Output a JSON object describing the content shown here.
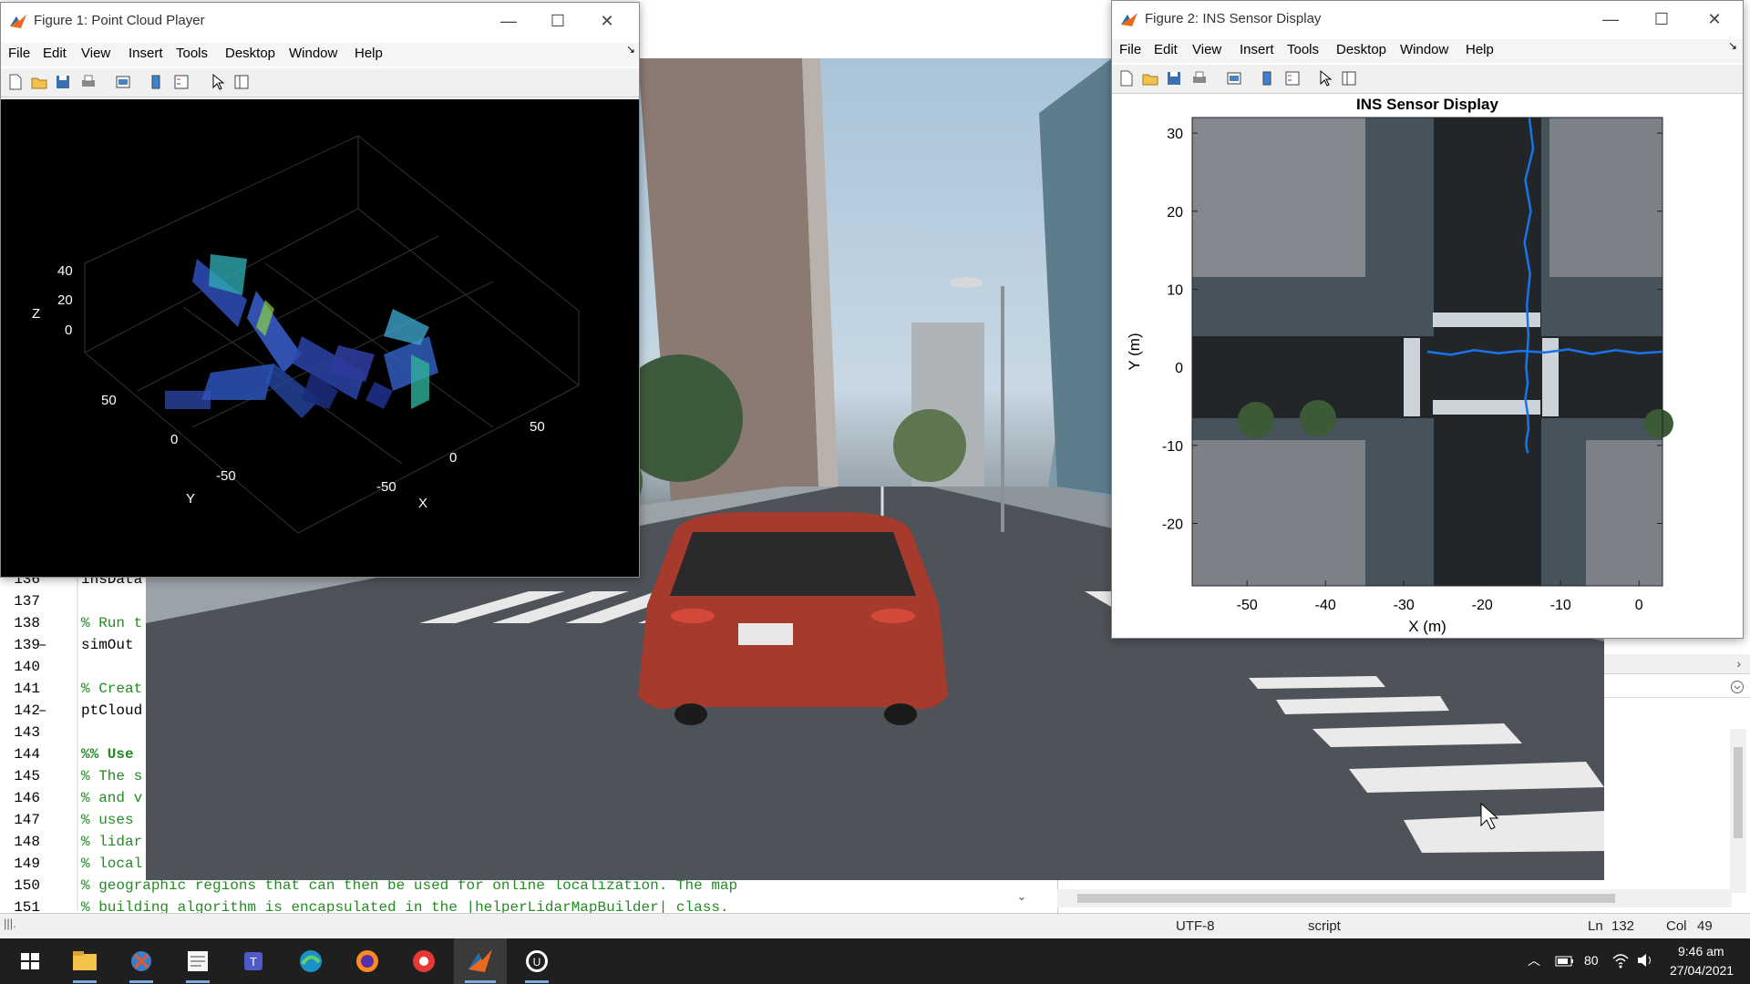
{
  "editor": {
    "lines": [
      {
        "num": "136",
        "dash": false,
        "text": "insData",
        "style": "code"
      },
      {
        "num": "137",
        "dash": false,
        "text": "",
        "style": "code"
      },
      {
        "num": "138",
        "dash": false,
        "text": "% Run t",
        "style": "cmt"
      },
      {
        "num": "139",
        "dash": true,
        "text": "simOut",
        "style": "code"
      },
      {
        "num": "140",
        "dash": false,
        "text": "",
        "style": "code"
      },
      {
        "num": "141",
        "dash": false,
        "text": "% Creat",
        "style": "cmt"
      },
      {
        "num": "142",
        "dash": true,
        "text": "ptCloud",
        "style": "code"
      },
      {
        "num": "143",
        "dash": false,
        "text": "",
        "style": "code"
      },
      {
        "num": "144",
        "dash": false,
        "text": "%% Use",
        "style": "cmt-b"
      },
      {
        "num": "145",
        "dash": false,
        "text": "% The s",
        "style": "cmt"
      },
      {
        "num": "146",
        "dash": false,
        "text": "% and v",
        "style": "cmt"
      },
      {
        "num": "147",
        "dash": false,
        "text": "% uses",
        "style": "cmt"
      },
      {
        "num": "148",
        "dash": false,
        "text": "% lidar",
        "style": "cmt"
      },
      {
        "num": "149",
        "dash": false,
        "text": "% local",
        "style": "cmt"
      },
      {
        "num": "150",
        "dash": false,
        "text": "% geographic regions that can then be used for online localization. The map",
        "style": "cmt"
      },
      {
        "num": "151",
        "dash": false,
        "text": "% building algorithm is encapsulated in the |helperLidarMapBuilder| class.",
        "style": "cmt"
      }
    ]
  },
  "figure1": {
    "title": "Figure 1: Point Cloud Player",
    "menu": [
      "File",
      "Edit",
      "View",
      "Insert",
      "Tools",
      "Desktop",
      "Window",
      "Help"
    ],
    "axes": {
      "zlabel": "Z",
      "ylabel": "Y",
      "xlabel": "X",
      "zticks": [
        "40",
        "20",
        "0"
      ],
      "yticks": [
        "50",
        "0",
        "-50"
      ],
      "xticks": [
        "50",
        "0",
        "-50"
      ]
    }
  },
  "figure2": {
    "title": "Figure 2: INS Sensor Display",
    "menu": [
      "File",
      "Edit",
      "View",
      "Insert",
      "Tools",
      "Desktop",
      "Window",
      "Help"
    ],
    "plot_title": "INS Sensor Display",
    "xlabel": "X (m)",
    "ylabel": "Y (m)"
  },
  "chart_data": {
    "type": "line",
    "title": "INS Sensor Display",
    "xlabel": "X (m)",
    "ylabel": "Y (m)",
    "xlim": [
      -57,
      3
    ],
    "ylim": [
      -28,
      32
    ],
    "xticks": [
      -50,
      -40,
      -30,
      -20,
      -10,
      0
    ],
    "yticks": [
      -20,
      -10,
      0,
      10,
      20,
      30
    ],
    "series": [
      {
        "x": [
          -14,
          -13.5,
          -14.5,
          -13.8,
          -14.6,
          -13.9,
          -14.3,
          -14.1,
          -14.4,
          -14.2,
          -14.5,
          -14.2,
          -14.1,
          -14.3,
          -14.4,
          -14.2
        ],
        "y": [
          32,
          28,
          24,
          20,
          16,
          12,
          8,
          4,
          0,
          -2,
          -4,
          -6,
          -8,
          -9,
          -10,
          -11
        ]
      },
      {
        "x": [
          -27,
          -24,
          -21,
          -18,
          -15,
          -12,
          -9,
          -6,
          -3,
          0,
          3
        ],
        "y": [
          2,
          1.6,
          2.2,
          1.8,
          2.1,
          1.9,
          2.3,
          1.7,
          2.2,
          1.8,
          2.0
        ]
      }
    ]
  },
  "statusbar": {
    "encoding": "UTF-8",
    "type": "script",
    "ln_label": "Ln",
    "ln": "132",
    "col_label": "Col",
    "col": "49"
  },
  "taskbar": {
    "time": "9:46 am",
    "date": "27/04/2021",
    "battery": "80"
  },
  "colors": {
    "comment": "#228b22",
    "trajectory": "#1a73e8",
    "taskbar": "#1f1f1f"
  }
}
